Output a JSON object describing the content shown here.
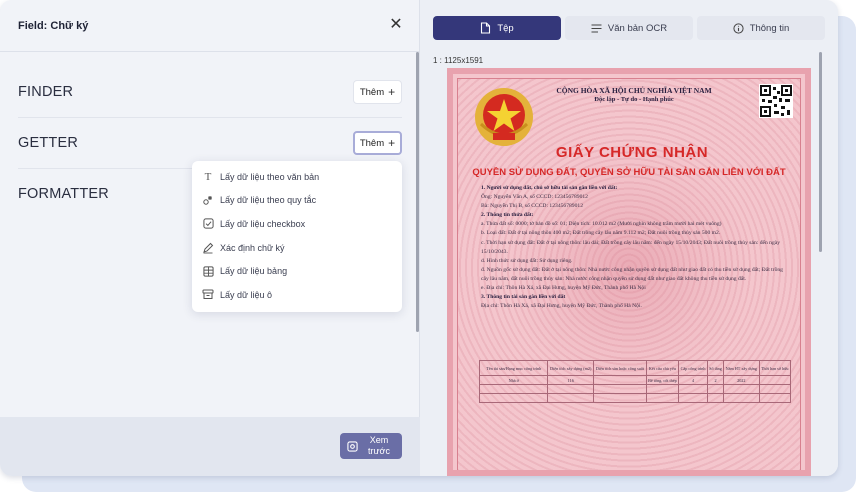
{
  "left_panel": {
    "title": "Field: Chữ ký",
    "sections": [
      {
        "label": "FINDER",
        "add_label": "Thêm"
      },
      {
        "label": "GETTER",
        "add_label": "Thêm"
      },
      {
        "label": "FORMATTER"
      }
    ],
    "dropdown": [
      {
        "label": "Lấy dữ liệu theo văn bản",
        "icon": "text-icon"
      },
      {
        "label": "Lấy dữ liệu theo quy tắc",
        "icon": "rule-icon"
      },
      {
        "label": "Lấy dữ liệu checkbox",
        "icon": "checkbox-icon"
      },
      {
        "label": "Xác định chữ ký",
        "icon": "signature-icon"
      },
      {
        "label": "Lấy dữ liệu bảng",
        "icon": "table-icon"
      },
      {
        "label": "Lấy dữ liệu ô",
        "icon": "cell-icon"
      }
    ],
    "preview_label": "Xem trước"
  },
  "right_panel": {
    "tabs": [
      {
        "label": "Tệp",
        "icon": "file-icon",
        "active": true
      },
      {
        "label": "Văn bản OCR",
        "icon": "lines-icon",
        "active": false
      },
      {
        "label": "Thông tin",
        "icon": "info-icon",
        "active": false
      }
    ],
    "image_size": "1 : 1125x1591",
    "certificate": {
      "nation": "CỘNG HÒA XÃ HỘI CHỦ NGHĨA VIỆT NAM",
      "motto": "Độc lập - Tự do - Hạnh phúc",
      "title": "GIẤY CHỨNG NHẬN",
      "subtitle": "QUYỀN SỬ DỤNG ĐẤT, QUYỀN SỞ HỮU TÀI SẢN GẮN LIỀN VỚI ĐẤT",
      "lines": [
        {
          "text": "1. Người sử dụng đất, chủ sở hữu tài sản gắn liền với đất:",
          "bold": true
        },
        {
          "text": "Ông: Nguyễn Văn A, số CCCD: 123456789012",
          "bold": false
        },
        {
          "text": "Bà: Nguyễn Thị B, số CCCD: 123456789012",
          "bold": false
        },
        {
          "text": "2. Thông tin thửa đất:",
          "bold": true
        },
        {
          "text": "a. Thửa đất số: 0000; tờ bản đồ số: 01; Diện tích: 10.012 m2 (Mười nghìn không trăm mười hai mét vuông)",
          "bold": false
        },
        {
          "text": "b. Loại đất: Đất ở tại nông thôn 400 m2; Đất trồng cây lâu năm 9.112 m2; Đất nuôi trồng thủy sản 500 m2.",
          "bold": false
        },
        {
          "text": "c. Thời hạn sử dụng đất: Đất ở tại nông thôn: lâu dài; Đất trồng cây lâu năm: đến ngày 15/10/2043; Đất nuôi trồng thủy sản: đến ngày 15/10/2043.",
          "bold": false
        },
        {
          "text": "d. Hình thức sử dụng đất: Sử dụng riêng.",
          "bold": false
        },
        {
          "text": "đ. Nguồn gốc sử dụng đất: Đất ở tại nông thôn: Nhà nước công nhận quyền sử dụng đất như giao đất có thu tiền sử dụng đất; Đất trồng cây lâu năm, đất nuôi trồng thủy sản: Nhà nước công nhận quyền sử dụng đất như giao đất không thu tiền sử dụng đất.",
          "bold": false
        },
        {
          "text": "e. Địa chỉ: Thôn Hà Xá, xã Đại Hưng, huyện Mỹ Đức, Thành phố Hà Nội",
          "bold": false
        },
        {
          "text": "3. Thông tin tài sản gắn liền với đất",
          "bold": true
        },
        {
          "text": "Địa chỉ: Thôn Hà Xá, xã Đại Hưng, huyện Mỹ Đức, Thành phố Hà Nội.",
          "bold": false
        }
      ],
      "table_headers": [
        "Tên tài sản/Hạng mục công trình",
        "Diện tích xây dựng (m2)",
        "Diện tích sàn hoặc công suất",
        "Kết cấu chủ yếu",
        "Cấp công trình",
        "Số tầng",
        "Năm HT xây dựng",
        "Thời hạn sở hữu"
      ],
      "table_row": [
        "Nhà ở",
        "116",
        "",
        "Bê tông, cốt thép",
        "4",
        "2",
        "2022",
        ""
      ]
    }
  }
}
